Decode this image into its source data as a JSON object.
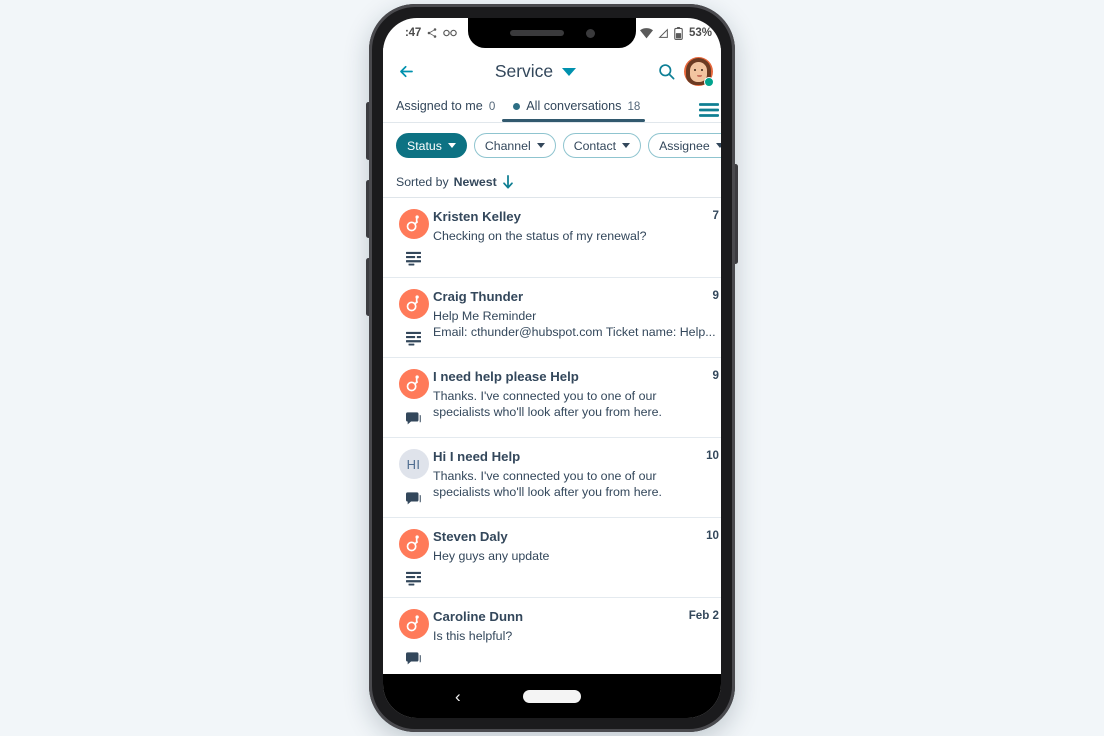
{
  "status_bar": {
    "time": ":47",
    "left_icons": [
      "bluetooth-share-icon",
      "voicemail-icon"
    ],
    "wifi_icon": "wifi-icon",
    "signal_icon": "signal-icon",
    "battery_icon": "battery-icon",
    "battery_pct": "53%"
  },
  "header": {
    "back_icon": "back-arrow-icon",
    "title": "Service",
    "dropdown_icon": "chevron-down-icon",
    "search_icon": "search-icon",
    "avatar": "user-avatar",
    "online_status": "online"
  },
  "tabs": [
    {
      "label": "Assigned to me",
      "count": "0",
      "active": false,
      "has_dot": false
    },
    {
      "label": "All conversations",
      "count": "18",
      "active": true,
      "has_dot": true
    }
  ],
  "tabs_menu_icon": "list-view-icon",
  "filters": [
    {
      "label": "Status",
      "selected": true,
      "icon": "chevron-down-icon"
    },
    {
      "label": "Channel",
      "selected": false,
      "icon": "chevron-down-icon"
    },
    {
      "label": "Contact",
      "selected": false,
      "icon": "chevron-down-icon"
    },
    {
      "label": "Assignee",
      "selected": false,
      "icon": "chevron-down-icon"
    }
  ],
  "sort": {
    "prefix": "Sorted by",
    "value": "Newest",
    "direction_icon": "arrow-down-icon"
  },
  "conversations": [
    {
      "name": "Kristen Kelley",
      "lines": [
        "Checking on the status of my renewal?"
      ],
      "time": "7 ",
      "avatar_type": "sprocket",
      "avatar_text": "",
      "channel_icon": "form-icon"
    },
    {
      "name": "Craig Thunder",
      "lines": [
        "Help Me Reminder",
        "Email: cthunder@hubspot.com Ticket name: Help..."
      ],
      "time": "9 ",
      "avatar_type": "sprocket",
      "avatar_text": "",
      "channel_icon": "form-icon"
    },
    {
      "name": "I need help please Help",
      "lines": [
        "Thanks. I've connected you to one of our",
        "specialists who'll look after you from here."
      ],
      "time": "9 ",
      "avatar_type": "sprocket",
      "avatar_text": "",
      "channel_icon": "chat-icon"
    },
    {
      "name": "Hi I need Help",
      "lines": [
        "Thanks. I've connected you to one of our",
        "specialists who'll look after you from here."
      ],
      "time": "10 ",
      "avatar_type": "initials",
      "avatar_text": "HI",
      "channel_icon": "chat-icon"
    },
    {
      "name": "Steven Daly",
      "lines": [
        "Hey guys any update"
      ],
      "time": "10 ",
      "avatar_type": "sprocket",
      "avatar_text": "",
      "channel_icon": "form-icon"
    },
    {
      "name": "Caroline Dunn",
      "lines": [
        "Is this helpful?"
      ],
      "time": "Feb 2",
      "avatar_type": "sprocket",
      "avatar_text": "",
      "channel_icon": "chat-icon"
    }
  ],
  "nav_bar": {
    "back_icon": "nav-back-icon",
    "home_pill": "home-indicator"
  },
  "colors": {
    "page_bg": "#f2f6f9",
    "accent_teal": "#0d7283",
    "brand_orange": "#ff7a59",
    "text_dark": "#33475b",
    "online_green": "#00a38d"
  }
}
